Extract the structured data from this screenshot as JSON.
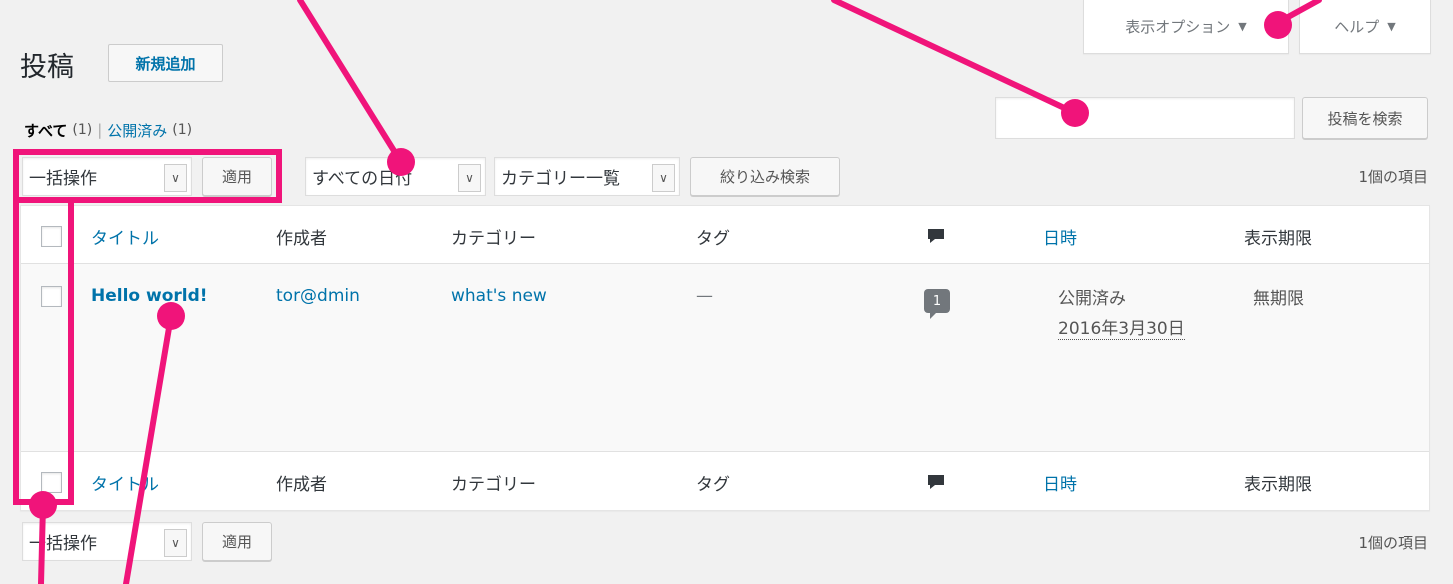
{
  "header": {
    "page_title": "投稿",
    "add_new_label": "新規追加",
    "screen_options_label": "表示オプション",
    "help_label": "ヘルプ"
  },
  "views": {
    "all_label": "すべて",
    "all_count": "(1)",
    "separator": "|",
    "published_label": "公開済み",
    "published_count": "(1)"
  },
  "search": {
    "value": "",
    "button_label": "投稿を検索"
  },
  "top_nav": {
    "bulk_action_selected": "一括操作",
    "apply_label": "適用",
    "date_filter_selected": "すべての日付",
    "category_filter_selected": "カテゴリー一覧",
    "filter_button_label": "絞り込み検索",
    "items_count": "1個の項目"
  },
  "table": {
    "headers": {
      "title": "タイトル",
      "author": "作成者",
      "categories": "カテゴリー",
      "tags": "タグ",
      "date": "日時",
      "expiry": "表示期限"
    },
    "rows": [
      {
        "title": "Hello world!",
        "author": "tor@dmin",
        "category": "what's new",
        "tags": "—",
        "comments": "1",
        "status": "公開済み",
        "date": "2016年3月30日",
        "expiry": "無期限"
      }
    ]
  },
  "bottom_nav": {
    "bulk_action_selected": "一括操作",
    "apply_label": "適用",
    "items_count": "1個の項目"
  },
  "colors": {
    "annotation": "#f0147a",
    "link": "#0073aa",
    "background": "#f1f1f1"
  }
}
